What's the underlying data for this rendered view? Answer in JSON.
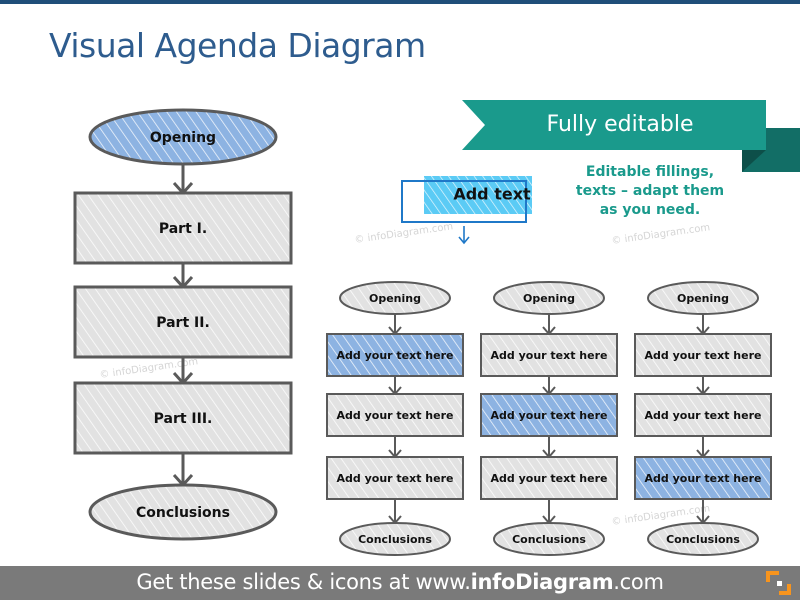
{
  "title": "Visual Agenda Diagram",
  "ribbon": {
    "label": "Fully editable",
    "color": "#1a9a8c",
    "fold_color": "#126e66"
  },
  "note": {
    "lines": [
      "Editable fillings,",
      "texts – adapt them",
      "as you need."
    ],
    "color": "#1a9a8c"
  },
  "sample_box": {
    "label": "Add text",
    "fill": "#5bcbf5",
    "border": "#1f78c8",
    "arrow": "down-arrow-icon"
  },
  "colors": {
    "highlight": "#8db3e2",
    "neutral": "#e2e2e2",
    "stroke": "#5a5a5a"
  },
  "main_flow": {
    "nodes": [
      {
        "label": "Opening",
        "shape": "ellipse",
        "highlight": true
      },
      {
        "label": "Part I.",
        "shape": "rect",
        "highlight": false
      },
      {
        "label": "Part II.",
        "shape": "rect",
        "highlight": false
      },
      {
        "label": "Part III.",
        "shape": "rect",
        "highlight": false
      },
      {
        "label": "Conclusions",
        "shape": "ellipse",
        "highlight": false
      }
    ]
  },
  "mini_flows": [
    {
      "nodes": [
        {
          "label": "Opening",
          "shape": "ellipse",
          "highlight": false
        },
        {
          "label": "Add your text here",
          "shape": "rect",
          "highlight": true
        },
        {
          "label": "Add your text here",
          "shape": "rect",
          "highlight": false
        },
        {
          "label": "Add your text here",
          "shape": "rect",
          "highlight": false
        },
        {
          "label": "Conclusions",
          "shape": "ellipse",
          "highlight": false
        }
      ]
    },
    {
      "nodes": [
        {
          "label": "Opening",
          "shape": "ellipse",
          "highlight": false
        },
        {
          "label": "Add your text here",
          "shape": "rect",
          "highlight": false
        },
        {
          "label": "Add your text here",
          "shape": "rect",
          "highlight": true
        },
        {
          "label": "Add your text here",
          "shape": "rect",
          "highlight": false
        },
        {
          "label": "Conclusions",
          "shape": "ellipse",
          "highlight": false
        }
      ]
    },
    {
      "nodes": [
        {
          "label": "Opening",
          "shape": "ellipse",
          "highlight": false
        },
        {
          "label": "Add your text here",
          "shape": "rect",
          "highlight": false
        },
        {
          "label": "Add your text here",
          "shape": "rect",
          "highlight": false
        },
        {
          "label": "Add your text here",
          "shape": "rect",
          "highlight": true
        },
        {
          "label": "Conclusions",
          "shape": "ellipse",
          "highlight": false
        }
      ]
    }
  ],
  "watermark": "© infoDiagram.com",
  "footer": {
    "prefix": "Get these slides & icons at www.",
    "brand": "infoDiagram",
    "suffix": ".com",
    "logo": "infodiagram-logo-icon",
    "logo_color": "#f7941d"
  }
}
